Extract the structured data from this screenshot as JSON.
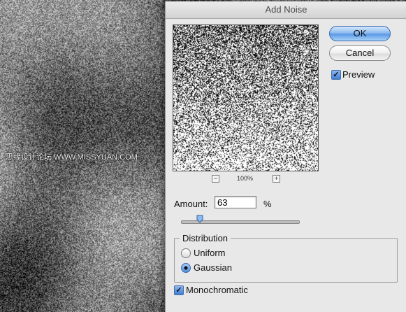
{
  "dialog": {
    "title": "Add Noise",
    "buttons": {
      "ok": "OK",
      "cancel": "Cancel"
    },
    "preview": {
      "label": "Preview",
      "checked": true
    },
    "zoom": {
      "minus": "−",
      "plus": "+",
      "level": "100%"
    },
    "amount": {
      "label": "Amount:",
      "value": "63",
      "unit": "%",
      "slider_fraction": 0.16
    },
    "distribution": {
      "title": "Distribution",
      "options": [
        {
          "label": "Uniform",
          "selected": false
        },
        {
          "label": "Gaussian",
          "selected": true
        }
      ]
    },
    "monochromatic": {
      "label": "Monochromatic",
      "checked": true
    }
  },
  "watermark": "思缘设计论坛  WWW.MISSYUAN.COM",
  "icons": {
    "checkmark": "check-icon",
    "zoom_out": "minus-icon",
    "zoom_in": "plus-icon"
  },
  "colors": {
    "dialog_bg": "#e8e8e8",
    "ok_button": "#5b9ae6",
    "accent": "#3d7fd6"
  }
}
